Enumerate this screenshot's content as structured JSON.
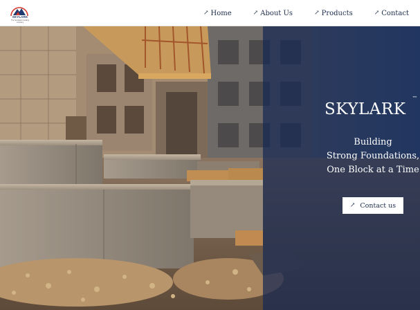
{
  "logo": {
    "text": "SKYLARK",
    "tagline": "The foundation building company"
  },
  "nav": {
    "items": [
      {
        "label": "Home",
        "icon": "arrow-up-right-icon"
      },
      {
        "label": "About Us",
        "icon": "arrow-up-right-icon"
      },
      {
        "label": "Products",
        "icon": "arrow-up-right-icon"
      },
      {
        "label": "Contact",
        "icon": "arrow-up-right-icon"
      }
    ]
  },
  "hero": {
    "brand": "SKYLARK",
    "trademark": "™",
    "tagline_lines": [
      "Building",
      "Strong Foundations,",
      "One Block at a Time"
    ],
    "cta_label": "Contact us",
    "cta_icon": "arrow-up-right-icon"
  },
  "colors": {
    "navy": "#1c2b4a",
    "overlay": "#162852",
    "logo_red": "#d43b2e",
    "logo_blue": "#1f3a6e"
  }
}
